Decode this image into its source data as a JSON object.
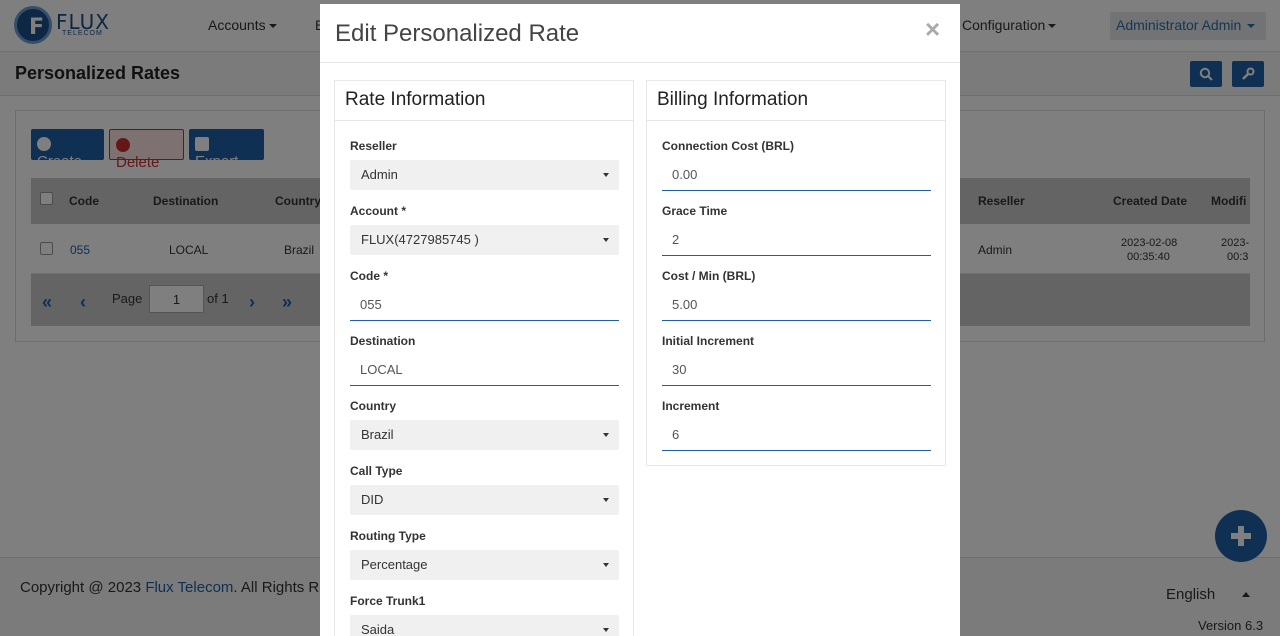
{
  "brand": {
    "name": "FLUX",
    "tagline": "TELECOM"
  },
  "nav": {
    "accounts": "Accounts",
    "partial": "B",
    "configuration": "Configuration",
    "user": "Administrator Admin"
  },
  "page": {
    "title": "Personalized Rates"
  },
  "toolbar": {
    "create": "Create",
    "delete": "Delete",
    "export": "Export"
  },
  "grid": {
    "headers": {
      "code": "Code",
      "destination": "Destination",
      "country": "Country",
      "reseller": "Reseller",
      "created": "Created Date",
      "modified": "Modifi"
    },
    "row": {
      "code": "055",
      "destination": "LOCAL",
      "country": "Brazil",
      "reseller": "Admin",
      "created_date": "2023-02-08",
      "created_time": "00:35:40",
      "modified_date": "2023-",
      "modified_time": "00:3"
    },
    "pagination": {
      "page_label": "Page",
      "page": "1",
      "of": "of 1"
    }
  },
  "footer": {
    "copyright_prefix": "Copyright @ 2023",
    "company": "Flux Telecom",
    "copyright_suffix": ". All Rights R",
    "language": "English",
    "version": "Version 6.3"
  },
  "modal": {
    "title": "Edit Personalized Rate",
    "close": "×",
    "rate_info": {
      "heading": "Rate Information",
      "reseller_label": "Reseller",
      "reseller_value": "Admin",
      "account_label": "Account *",
      "account_value": "FLUX(4727985745 )",
      "code_label": "Code *",
      "code_value": "055",
      "destination_label": "Destination",
      "destination_value": "LOCAL",
      "country_label": "Country",
      "country_value": "Brazil",
      "call_type_label": "Call Type",
      "call_type_value": "DID",
      "routing_type_label": "Routing Type",
      "routing_type_value": "Percentage",
      "force_trunk_label": "Force Trunk1",
      "force_trunk_value": "Saida"
    },
    "billing_info": {
      "heading": "Billing Information",
      "connection_cost_label": "Connection Cost (BRL)",
      "connection_cost_value": "0.00",
      "grace_time_label": "Grace Time",
      "grace_time_value": "2",
      "cost_min_label": "Cost / Min (BRL)",
      "cost_min_value": "5.00",
      "initial_increment_label": "Initial Increment",
      "initial_increment_value": "30",
      "increment_label": "Increment",
      "increment_value": "6"
    }
  },
  "colors": {
    "primary": "#1f5fa6",
    "danger": "#c9302c",
    "overlay": "rgba(0,0,0,0.5)"
  }
}
